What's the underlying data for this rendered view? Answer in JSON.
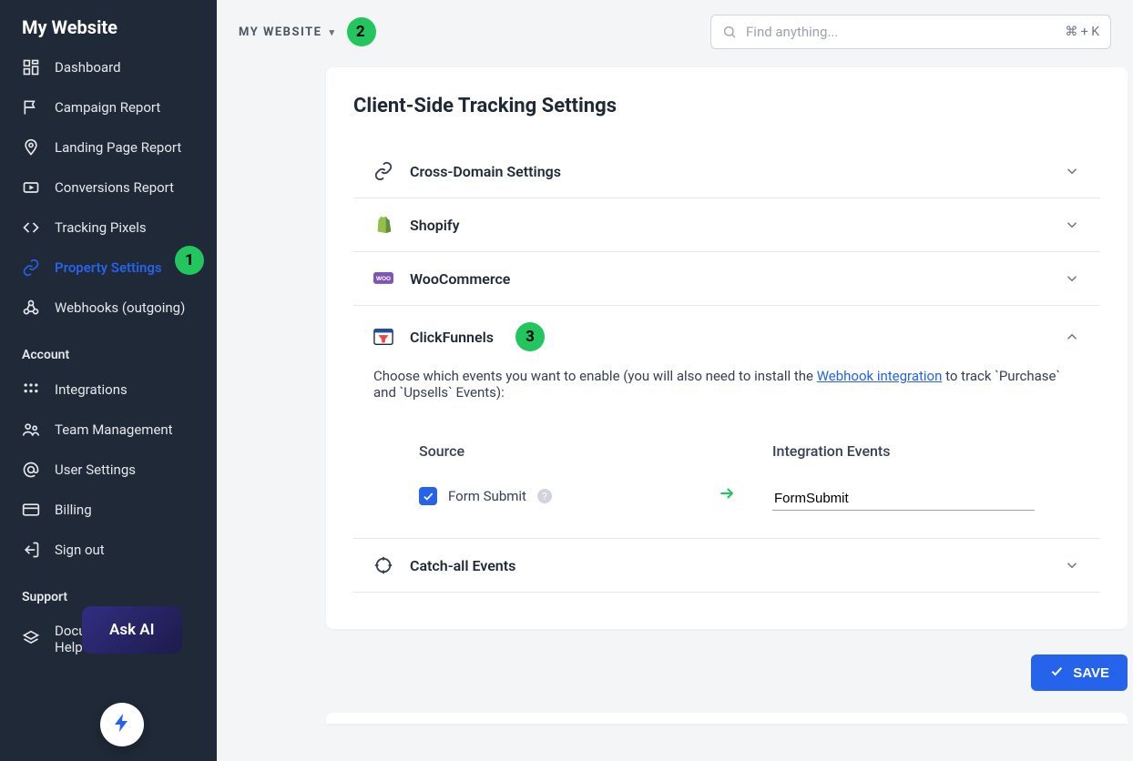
{
  "brand": "My Website",
  "sidebar": {
    "main": [
      {
        "label": "Dashboard",
        "icon": "dashboard"
      },
      {
        "label": "Campaign Report",
        "icon": "flag"
      },
      {
        "label": "Landing Page Report",
        "icon": "pin"
      },
      {
        "label": "Conversions Report",
        "icon": "conversions"
      },
      {
        "label": "Tracking Pixels",
        "icon": "code"
      },
      {
        "label": "Property Settings",
        "icon": "link",
        "active": true
      },
      {
        "label": "Webhooks (outgoing)",
        "icon": "webhook"
      }
    ],
    "account_title": "Account",
    "account": [
      {
        "label": "Integrations",
        "icon": "apps"
      },
      {
        "label": "Team Management",
        "icon": "team"
      },
      {
        "label": "User Settings",
        "icon": "at"
      },
      {
        "label": "Billing",
        "icon": "card"
      },
      {
        "label": "Sign out",
        "icon": "signout"
      }
    ],
    "support_title": "Support",
    "support": [
      {
        "label": "Documentation and Help",
        "icon": "doc"
      }
    ]
  },
  "breadcrumb": "MY WEBSITE",
  "search_placeholder": "Find anything...",
  "search_shortcut": "⌘ + K",
  "card_title": "Client-Side Tracking Settings",
  "sections": {
    "cross_domain": "Cross-Domain Settings",
    "shopify": "Shopify",
    "woocommerce": "WooCommerce",
    "clickfunnels": "ClickFunnels",
    "catch_all": "Catch-all Events"
  },
  "clickfunnels": {
    "desc_prefix": "Choose which events you want to enable (you will also need to install the ",
    "desc_link": "Webhook integration",
    "desc_suffix": " to track `Purchase` and `Upsells` Events):",
    "source_label": "Source",
    "integration_label": "Integration Events",
    "event_name": "Form Submit",
    "integration_value": "FormSubmit"
  },
  "save_label": "SAVE",
  "ask_ai": "Ask AI",
  "badges": {
    "b1": "1",
    "b2": "2",
    "b3": "3"
  }
}
